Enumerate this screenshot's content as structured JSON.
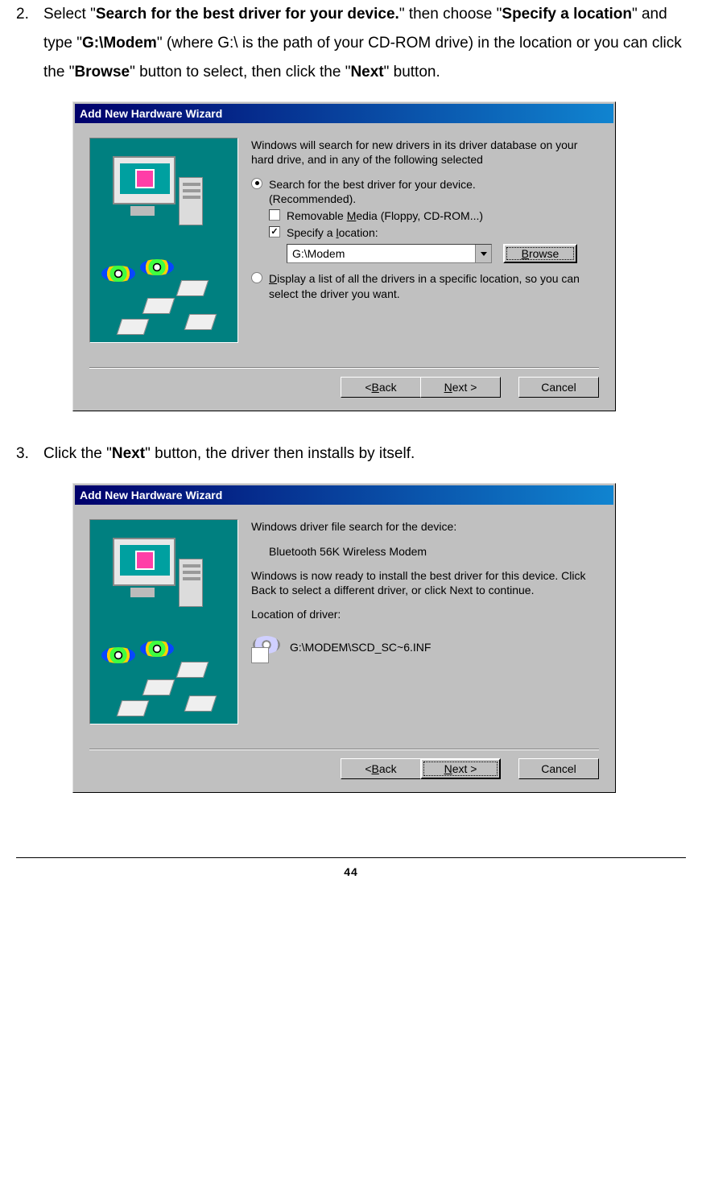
{
  "step2": {
    "num": "2.",
    "t1": "Select \"",
    "b1": "Search for the best driver for your device.",
    "t2": "\" then choose \"",
    "b2": "Specify a location",
    "t3": "\" and type \"",
    "b3": "G:\\Modem",
    "t4": "\" (where G:\\ is the path of your CD-ROM drive) in the location or you can click the \"",
    "b4": "Browse",
    "t5": "\" button to select, then click the \"",
    "b5": "Next",
    "t6": "\" button."
  },
  "step3": {
    "num": "3.",
    "t1": "Click the \"",
    "b1": "Next",
    "t2": "\" button, the driver then installs by itself."
  },
  "wiz1": {
    "title": "Add New Hardware Wizard",
    "intro": "Windows will search for new drivers in its driver database on your hard drive, and in any of the following selected",
    "opt1_line1": "Search for the best driver for your device.",
    "opt1_line2": "(Recommended).",
    "chk1_pre": "Removable ",
    "chk1_u": "M",
    "chk1_post": "edia (Floppy, CD-ROM...)",
    "chk2_pre": "Specify a ",
    "chk2_u": "l",
    "chk2_post": "ocation:",
    "loc_value": "G:\\Modem",
    "browse_u": "B",
    "browse_post": "rowse",
    "opt2_u": "D",
    "opt2_post": "isplay a list of all the drivers in a specific location, so you can select the driver you want.",
    "back_pre": "< ",
    "back_u": "B",
    "back_post": "ack",
    "next_u": "N",
    "next_post": "ext >",
    "cancel": "Cancel"
  },
  "wiz2": {
    "title": "Add New Hardware Wizard",
    "l1": "Windows driver file search for the device:",
    "device": "Bluetooth 56K Wireless Modem",
    "l2": "Windows is now ready to install the best driver for this device. Click Back to select a different driver, or click Next to continue.",
    "loc_label": "Location of driver:",
    "loc_path": "G:\\MODEM\\SCD_SC~6.INF",
    "back_pre": "< ",
    "back_u": "B",
    "back_post": "ack",
    "next_u": "N",
    "next_post": "ext >",
    "cancel": "Cancel"
  },
  "page_number": "44"
}
